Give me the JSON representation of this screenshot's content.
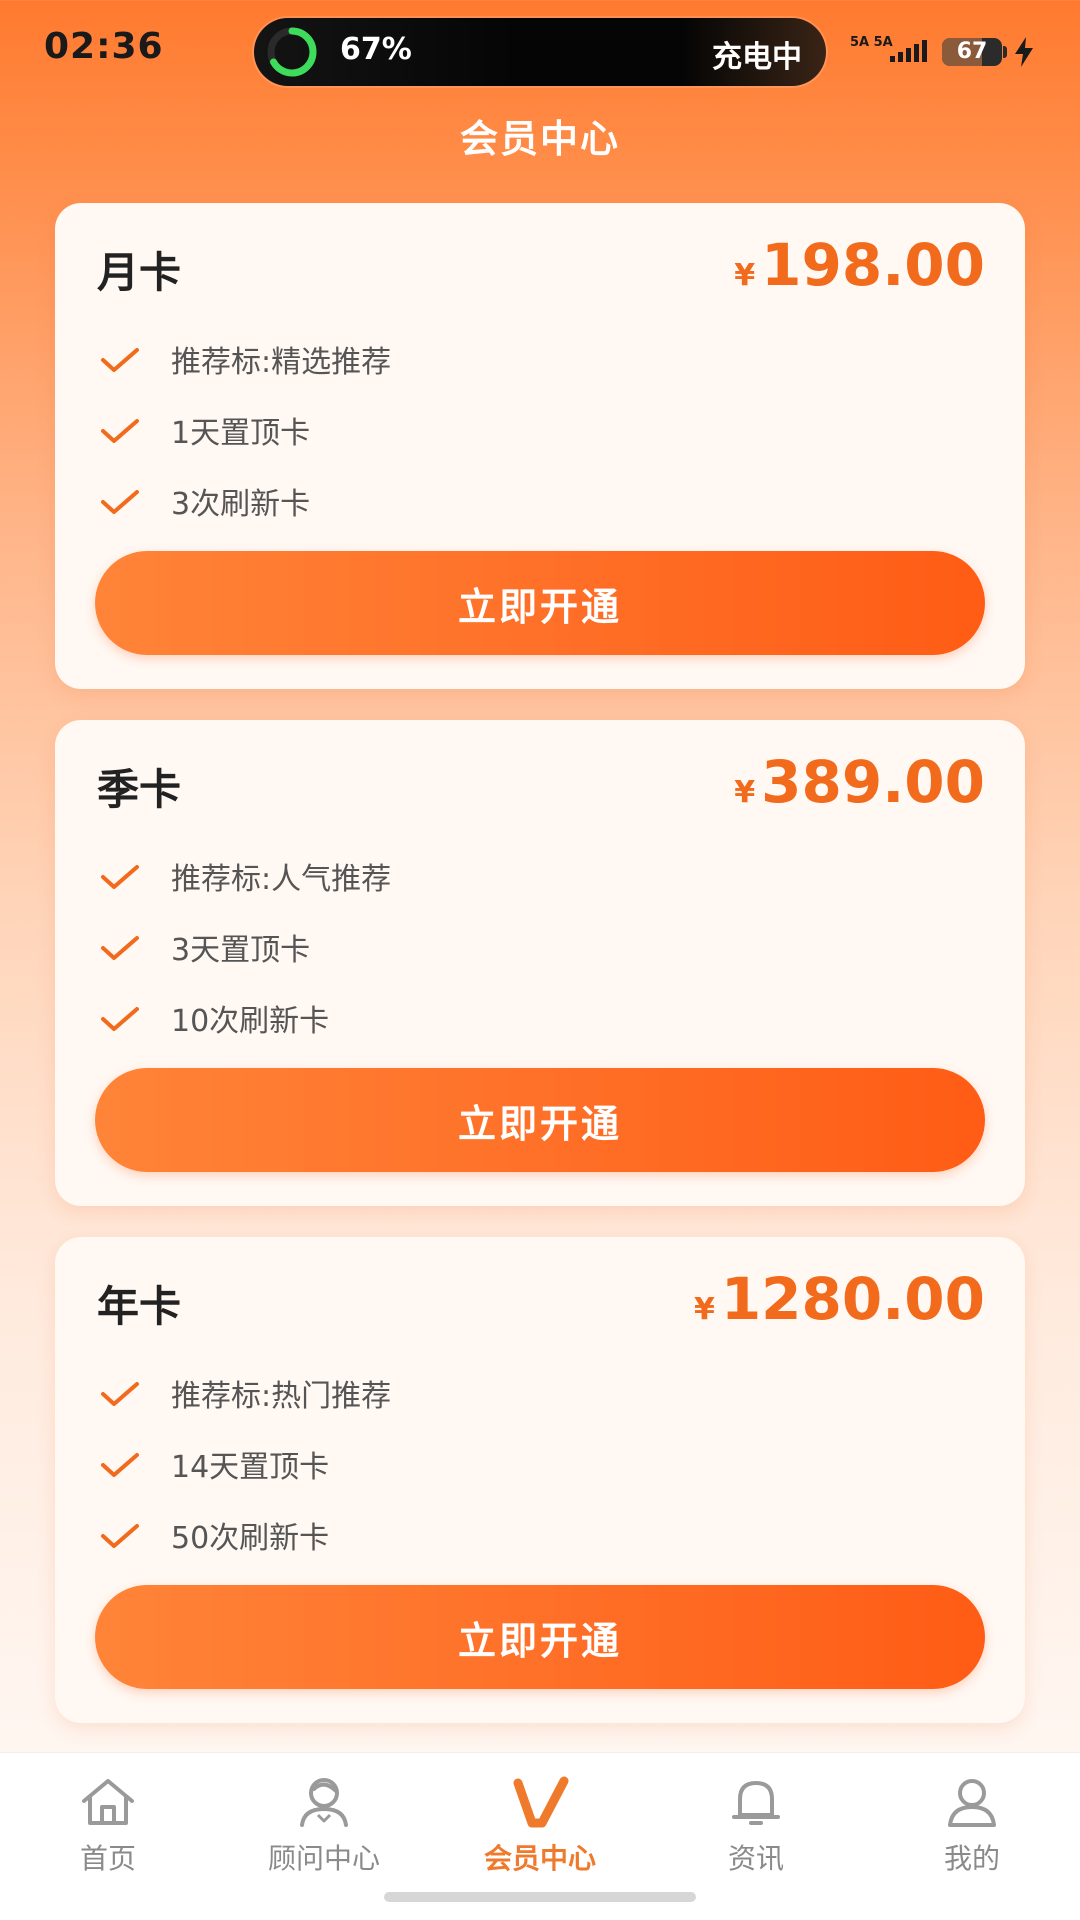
{
  "status_bar": {
    "time": "02:36",
    "island_percent": "67%",
    "island_status": "充电中",
    "signal_label": "5A 5A",
    "battery_level": "67"
  },
  "header": {
    "title": "会员中心"
  },
  "colors": {
    "accent": "#ff6a1f",
    "price": "#f26a1c",
    "tab_active": "#f07a2c",
    "tab_inactive": "#8a8a8a",
    "charging_ring": "#3ddc5a"
  },
  "plans": [
    {
      "name": "月卡",
      "currency": "¥",
      "price": "198.00",
      "features": [
        "推荐标:精选推荐",
        "1天置顶卡",
        "3次刷新卡"
      ],
      "button": "立即开通"
    },
    {
      "name": "季卡",
      "currency": "¥",
      "price": "389.00",
      "features": [
        "推荐标:人气推荐",
        "3天置顶卡",
        "10次刷新卡"
      ],
      "button": "立即开通"
    },
    {
      "name": "年卡",
      "currency": "¥",
      "price": "1280.00",
      "features": [
        "推荐标:热门推荐",
        "14天置顶卡",
        "50次刷新卡"
      ],
      "button": "立即开通"
    }
  ],
  "tabs": [
    {
      "label": "首页",
      "icon": "home-icon",
      "active": false
    },
    {
      "label": "顾问中心",
      "icon": "advisor-icon",
      "active": false
    },
    {
      "label": "会员中心",
      "icon": "vip-icon",
      "active": true
    },
    {
      "label": "资讯",
      "icon": "bell-icon",
      "active": false
    },
    {
      "label": "我的",
      "icon": "profile-icon",
      "active": false
    }
  ]
}
